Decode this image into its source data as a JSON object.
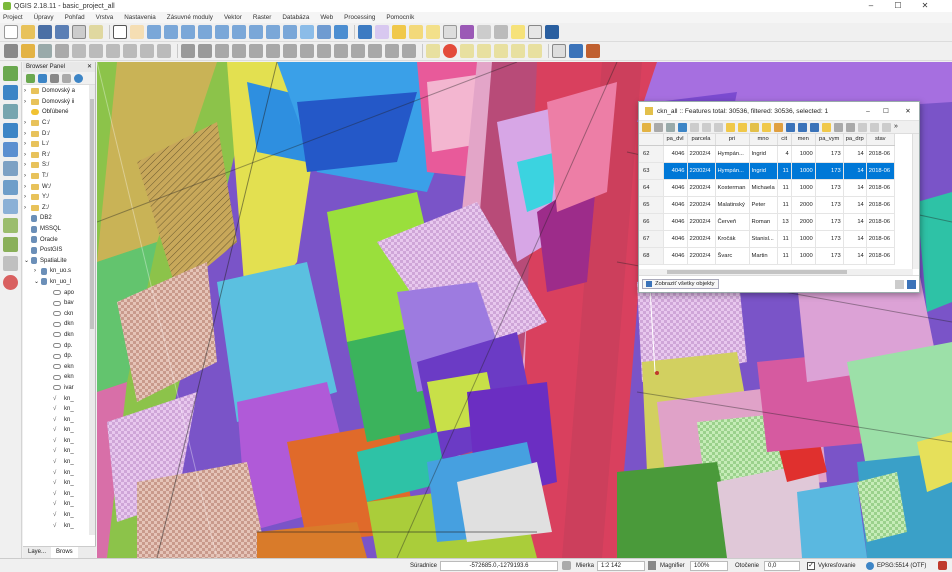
{
  "window": {
    "title": "QGIS 2.18.11 - basic_project_all",
    "minimize": "–",
    "maximize": "☐",
    "close": "✕"
  },
  "menu": [
    "Project",
    "Úpravy",
    "Pohľad",
    "Vrstva",
    "Nastavenia",
    "Zásuvné moduly",
    "Vektor",
    "Raster",
    "Databáza",
    "Web",
    "Processing",
    "Pomocník"
  ],
  "browser": {
    "title": "Browser Panel",
    "items": [
      {
        "label": "Domovský a",
        "icon": "folder-icon",
        "expand": "›"
      },
      {
        "label": "Domovský ii",
        "icon": "folder-icon",
        "expand": "›"
      },
      {
        "label": "Obľúbené",
        "icon": "star-icon",
        "expand": ""
      },
      {
        "label": "C:/",
        "icon": "folder-icon",
        "expand": "›"
      },
      {
        "label": "D:/",
        "icon": "folder-icon",
        "expand": "›"
      },
      {
        "label": "L:/",
        "icon": "folder-icon",
        "expand": "›"
      },
      {
        "label": "R:/",
        "icon": "folder-icon",
        "expand": "›"
      },
      {
        "label": "S:/",
        "icon": "folder-icon",
        "expand": "›"
      },
      {
        "label": "T:/",
        "icon": "folder-icon",
        "expand": "›"
      },
      {
        "label": "W:/",
        "icon": "folder-icon",
        "expand": "›"
      },
      {
        "label": "Y:/",
        "icon": "folder-icon",
        "expand": "›"
      },
      {
        "label": "Z:/",
        "icon": "folder-icon",
        "expand": "›"
      },
      {
        "label": "DB2",
        "icon": "db-icon",
        "expand": ""
      },
      {
        "label": "MSSQL",
        "icon": "db-icon",
        "expand": ""
      },
      {
        "label": "Oracle",
        "icon": "db-icon",
        "expand": ""
      },
      {
        "label": "PostGIS",
        "icon": "db-icon",
        "expand": ""
      },
      {
        "label": "SpatiaLite",
        "icon": "db-icon",
        "expand": "⌄"
      },
      {
        "label": "kn_uo.s",
        "icon": "db-icon",
        "expand": "›"
      },
      {
        "label": "kn_uo_l",
        "icon": "db-icon",
        "expand": "⌄"
      },
      {
        "label": "apo",
        "icon": "layer-icon",
        "expand": ""
      },
      {
        "label": "bav",
        "icon": "layer-icon",
        "expand": ""
      },
      {
        "label": "ckn",
        "icon": "layer-icon",
        "expand": ""
      },
      {
        "label": "dkn",
        "icon": "layer-icon",
        "expand": ""
      },
      {
        "label": "dkn",
        "icon": "layer-icon",
        "expand": ""
      },
      {
        "label": "dp.",
        "icon": "layer-icon",
        "expand": ""
      },
      {
        "label": "dp.",
        "icon": "layer-icon",
        "expand": ""
      },
      {
        "label": "ekn",
        "icon": "layer-icon",
        "expand": ""
      },
      {
        "label": "ekn",
        "icon": "layer-icon",
        "expand": ""
      },
      {
        "label": "ivar",
        "icon": "layer-icon",
        "expand": ""
      },
      {
        "label": "kn_",
        "icon": "line-icon",
        "expand": ""
      },
      {
        "label": "kn_",
        "icon": "line-icon",
        "expand": ""
      },
      {
        "label": "kn_",
        "icon": "line-icon",
        "expand": ""
      },
      {
        "label": "kn_",
        "icon": "line-icon",
        "expand": ""
      },
      {
        "label": "kn_",
        "icon": "line-icon",
        "expand": ""
      },
      {
        "label": "kn_",
        "icon": "line-icon",
        "expand": ""
      },
      {
        "label": "kn_",
        "icon": "line-icon",
        "expand": ""
      },
      {
        "label": "kn_",
        "icon": "line-icon",
        "expand": ""
      },
      {
        "label": "kn_",
        "icon": "line-icon",
        "expand": ""
      },
      {
        "label": "kn_",
        "icon": "line-icon",
        "expand": ""
      },
      {
        "label": "kn_",
        "icon": "line-icon",
        "expand": ""
      },
      {
        "label": "kn_",
        "icon": "line-icon",
        "expand": ""
      },
      {
        "label": "kn_",
        "icon": "line-icon",
        "expand": ""
      }
    ],
    "tabs": [
      "Laye...",
      "Brows"
    ]
  },
  "attribute_table": {
    "title": "ckn_all :: Features total: 30536, filtered: 30536, selected: 1",
    "columns": [
      "pa_dvl",
      "parcela",
      "pri",
      "mno",
      "cit",
      "men",
      "pa_vym",
      "pa_drp",
      "stav"
    ],
    "rows": [
      {
        "rn": "62",
        "cells": [
          "4046",
          "22002/4",
          "Hympán...",
          "Ingrid",
          "4",
          "1000",
          "173",
          "14",
          "2018-06"
        ],
        "selected": false
      },
      {
        "rn": "63",
        "cells": [
          "4046",
          "22002/4",
          "Hympán...",
          "Ingrid",
          "11",
          "1000",
          "173",
          "14",
          "2018-06"
        ],
        "selected": true
      },
      {
        "rn": "64",
        "cells": [
          "4046",
          "22002/4",
          "Kosterman",
          "Michaela",
          "11",
          "1000",
          "173",
          "14",
          "2018-06"
        ],
        "selected": false
      },
      {
        "rn": "65",
        "cells": [
          "4046",
          "22002/4",
          "Malatinský",
          "Peter",
          "11",
          "2000",
          "173",
          "14",
          "2018-06"
        ],
        "selected": false
      },
      {
        "rn": "66",
        "cells": [
          "4046",
          "22002/4",
          "Červeň",
          "Roman",
          "13",
          "2000",
          "173",
          "14",
          "2018-06"
        ],
        "selected": false
      },
      {
        "rn": "67",
        "cells": [
          "4046",
          "22002/4",
          "Kročák",
          "Stanisl...",
          "11",
          "1000",
          "173",
          "14",
          "2018-06"
        ],
        "selected": false
      },
      {
        "rn": "68",
        "cells": [
          "4046",
          "22002/4",
          "Švarc",
          "Martin",
          "11",
          "1000",
          "173",
          "14",
          "2018-06"
        ],
        "selected": false
      }
    ],
    "filter_button": "Zobraziť všetky objekty"
  },
  "status": {
    "coord_label": "Súradnice",
    "coord_value": "-572685.0,-1279193.6",
    "scale_label": "Mierka",
    "scale_value": "1:2 142",
    "magnifier_label": "Magnifier",
    "magnifier_value": "100%",
    "rotation_label": "Otočenie",
    "rotation_value": "0,0",
    "render_label": "Vykresľovanie",
    "crs": "EPSG:5514 (OTF)"
  },
  "colors": {
    "selection": "#0078d7",
    "accent": "#7cba3c"
  }
}
